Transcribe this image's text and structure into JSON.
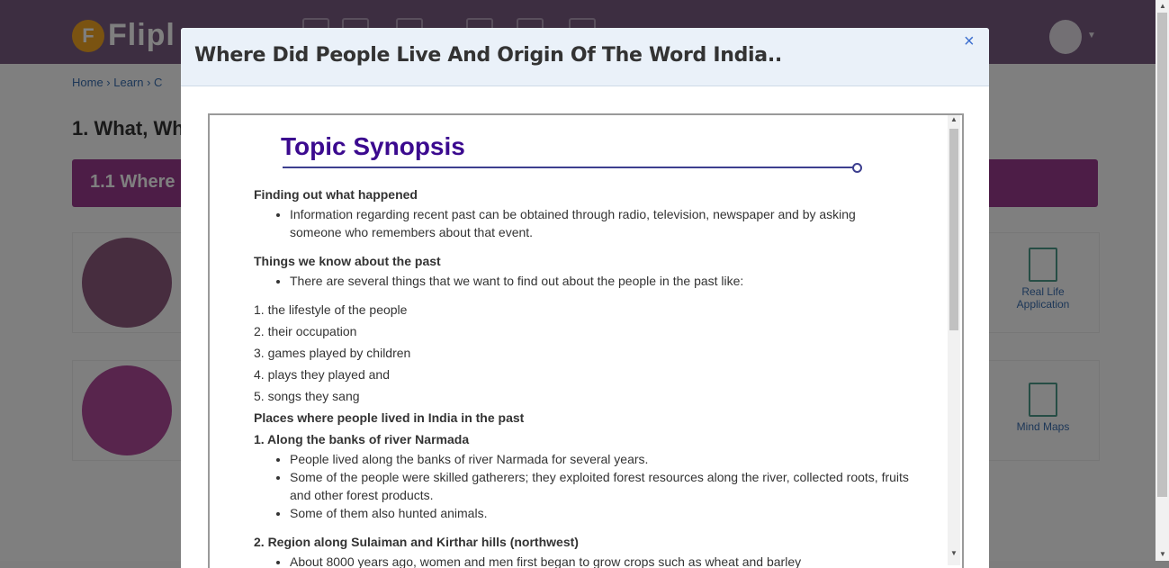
{
  "background": {
    "logo_text": "Flipl",
    "breadcrumb": "Home  ›  Learn  ›  C",
    "chapter_title": "1. What, Wh",
    "section_band": "1.1 Where ",
    "side_items": [
      "Real Life Application",
      "Mind Maps"
    ]
  },
  "modal": {
    "title": "Where Did People Live And Origin Of The Word India..",
    "close_label": "×"
  },
  "synopsis": {
    "title": "Topic Synopsis",
    "section1": {
      "heading": "Finding out what happened",
      "bullets": [
        "Information regarding recent past can be obtained through radio, television, newspaper and by asking someone who remembers about that event."
      ]
    },
    "section2": {
      "heading": "Things we know about the past",
      "bullets": [
        "There are several things that we want to find out about the people in the past like:"
      ],
      "numbered": [
        "1. the lifestyle of the people",
        "2. their occupation",
        "3. games played by children",
        "4. plays they played and",
        "5. songs they sang"
      ]
    },
    "section3": {
      "heading": "Places where people lived in India in the past"
    },
    "place1": {
      "heading": "1. Along the banks of river Narmada",
      "bullets": [
        "People lived along the banks of river Narmada for several years.",
        "Some of the people were skilled gatherers; they exploited forest resources along the river, collected roots, fruits and other forest products.",
        "Some of them also hunted animals."
      ]
    },
    "place2": {
      "heading": "2. Region along Sulaiman and Kirthar hills (northwest)",
      "bullets": [
        "About 8000 years ago, women and men first began to grow crops such as wheat and barley"
      ]
    }
  }
}
